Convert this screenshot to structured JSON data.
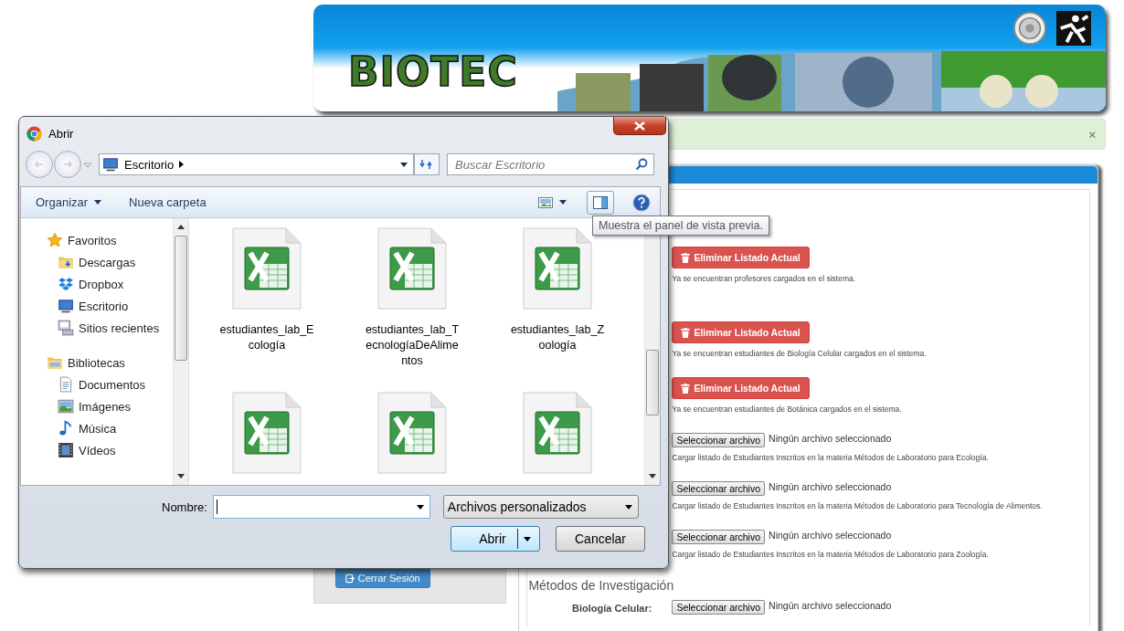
{
  "site": {
    "logo": "BIOTEC",
    "alert": {
      "close": "×"
    },
    "logout_button": "Cerrar Sesión",
    "sections": [
      {
        "entries": [
          {
            "kind": "delete",
            "button": "Eliminar Listado Actual",
            "note": "Ya se encuentran profesores cargados en el sistema."
          }
        ]
      },
      {
        "entries": [
          {
            "kind": "delete",
            "button": "Eliminar Listado Actual",
            "note": "Ya se encuentran estudiantes de Biología Celular cargados en el sistema."
          },
          {
            "kind": "delete",
            "button": "Eliminar Listado Actual",
            "note": "Ya se encuentran estudiantes de Botánica cargados en el sistema."
          },
          {
            "kind": "upload",
            "button": "Seleccionar archivo",
            "status": "Ningún archivo seleccionado",
            "note": "Cargar listado de Estudiantes Inscritos en la materia Métodos de Laboratorio para Ecología."
          },
          {
            "kind": "upload",
            "button": "Seleccionar archivo",
            "status": "Ningún archivo seleccionado",
            "note": "Cargar listado de Estudiantes Inscritos en la materia Métodos de Laboratorio para Tecnología de Alimentos."
          },
          {
            "kind": "upload",
            "button": "Seleccionar archivo",
            "status": "Ningún archivo seleccionado",
            "note": "Cargar listado de Estudiantes Inscritos en la materia Métodos de Laboratorio para Zoología."
          }
        ]
      },
      {
        "heading": "Métodos de Investigación",
        "entries": [
          {
            "kind": "upload",
            "label": "Biología Celular:",
            "button": "Seleccionar archivo",
            "status": "Ningún archivo seleccionado"
          }
        ]
      }
    ]
  },
  "dialog": {
    "title": "Abrir",
    "address": "Escritorio",
    "search": {
      "placeholder": "Buscar Escritorio"
    },
    "toolbar": {
      "organize": "Organizar",
      "new_folder": "Nueva carpeta",
      "tooltip": "Muestra el panel de vista previa."
    },
    "nav": [
      {
        "label": "Favoritos",
        "children": [
          {
            "label": "Descargas"
          },
          {
            "label": "Dropbox"
          },
          {
            "label": "Escritorio"
          },
          {
            "label": "Sitios recientes"
          }
        ]
      },
      {
        "label": "Bibliotecas",
        "children": [
          {
            "label": "Documentos"
          },
          {
            "label": "Imágenes"
          },
          {
            "label": "Música"
          },
          {
            "label": "Vídeos"
          }
        ]
      }
    ],
    "files": [
      {
        "name": "estudiantes_lab_Ecología",
        "cut_off": false
      },
      {
        "name": "estudiantes_lab_TecnologíaDeAlimentos",
        "cut_off": false
      },
      {
        "name": "estudiantes_lab_Zoología",
        "cut_off": false
      },
      {
        "cut_off": true
      },
      {
        "cut_off": true
      },
      {
        "cut_off": true
      }
    ],
    "name_label": "Nombre:",
    "filter": "Archivos personalizados",
    "open_button": "Abrir",
    "cancel_button": "Cancelar"
  }
}
